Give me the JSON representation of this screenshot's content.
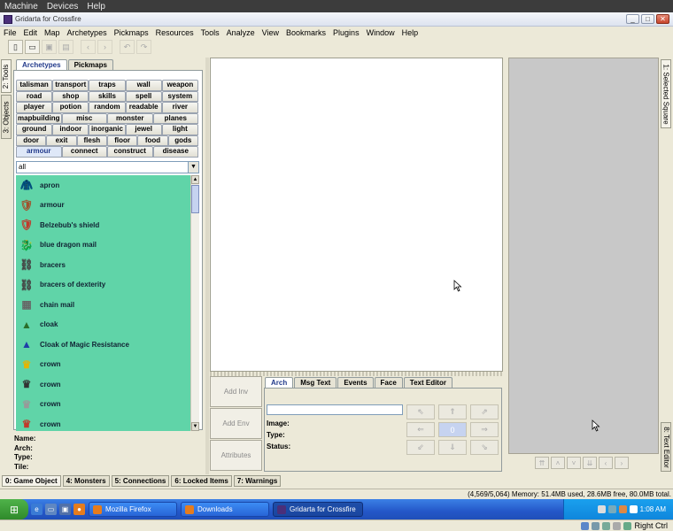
{
  "vbox_menu": [
    "Machine",
    "Devices",
    "Help"
  ],
  "window": {
    "title": "Gridarta for Crossfire"
  },
  "menubar": [
    "File",
    "Edit",
    "Map",
    "Archetypes",
    "Pickmaps",
    "Resources",
    "Tools",
    "Analyze",
    "View",
    "Bookmarks",
    "Plugins",
    "Window",
    "Help"
  ],
  "left_vtabs": [
    "2: Tools",
    "3: Objects"
  ],
  "right_vtabs": [
    "1: Selected Square",
    "8: Text Editor"
  ],
  "left_tabs": [
    "Archetypes",
    "Pickmaps"
  ],
  "categories": [
    [
      "talisman",
      "transport",
      "traps",
      "wall",
      "weapon"
    ],
    [
      "road",
      "shop",
      "skills",
      "spell",
      "system"
    ],
    [
      "player",
      "potion",
      "random",
      "readable",
      "river"
    ],
    [
      "mapbuilding",
      "misc",
      "monster",
      "planes"
    ],
    [
      "ground",
      "indoor",
      "inorganic",
      "jewel",
      "light"
    ],
    [
      "door",
      "exit",
      "flesh",
      "floor",
      "food",
      "gods"
    ],
    [
      "armour",
      "connect",
      "construct",
      "disease"
    ]
  ],
  "selected_category": "armour",
  "filter_value": "all",
  "arch_list": [
    {
      "label": "apron",
      "icon": "apron-icon",
      "glyph": "🧥",
      "color": "#c88a3a"
    },
    {
      "label": "armour",
      "icon": "armour-icon",
      "glyph": "🛡",
      "color": "#a0522d"
    },
    {
      "label": "Belzebub's shield",
      "icon": "shield-icon",
      "glyph": "🛡",
      "color": "#c0392b"
    },
    {
      "label": "blue dragon mail",
      "icon": "dragon-mail-icon",
      "glyph": "🐉",
      "color": "#2c4fbf"
    },
    {
      "label": "bracers",
      "icon": "bracers-icon",
      "glyph": "⛓",
      "color": "#444"
    },
    {
      "label": "bracers of dexterity",
      "icon": "bracers-icon",
      "glyph": "⛓",
      "color": "#444"
    },
    {
      "label": "chain mail",
      "icon": "chain-mail-icon",
      "glyph": "▦",
      "color": "#666"
    },
    {
      "label": "cloak",
      "icon": "cloak-icon",
      "glyph": "▲",
      "color": "#2a6e2a"
    },
    {
      "label": "Cloak of Magic Resistance",
      "icon": "cloak-icon",
      "glyph": "▲",
      "color": "#1f3ea8"
    },
    {
      "label": "crown",
      "icon": "crown-icon",
      "glyph": "♛",
      "color": "#e6b400"
    },
    {
      "label": "crown",
      "icon": "crown-icon",
      "glyph": "♛",
      "color": "#333"
    },
    {
      "label": "crown",
      "icon": "crown-icon",
      "glyph": "♛",
      "color": "#999"
    },
    {
      "label": "crown",
      "icon": "crown-icon",
      "glyph": "♛",
      "color": "#c0392b"
    }
  ],
  "props": [
    "Name:",
    "Arch:",
    "Type:",
    "Tile:"
  ],
  "side_buttons": [
    "Add Inv",
    "Add Env",
    "Attributes"
  ],
  "attr_tabs": [
    "Arch",
    "Msg Text",
    "Events",
    "Face",
    "Text Editor"
  ],
  "attr_labels": [
    "Image:",
    "Type:",
    "Status:"
  ],
  "dir_buttons": [
    "⇖",
    "⇑",
    "⇗",
    "⇐",
    "0",
    "⇒",
    "⇙",
    "⇓",
    "⇘"
  ],
  "bottom_tabs": [
    "0: Game Object",
    "4: Monsters",
    "5: Connections",
    "6: Locked Items",
    "7: Warnings"
  ],
  "status_text": "(4,569/5,064) Memory: 51.4MB used, 28.6MB free, 80.0MB total.",
  "taskbar": {
    "tasks": [
      "Mozilla Firefox",
      "Downloads",
      "Gridarta for Crossfire"
    ],
    "clock": "1:08 AM"
  },
  "vbox_status": {
    "host_key": "Right Ctrl"
  }
}
